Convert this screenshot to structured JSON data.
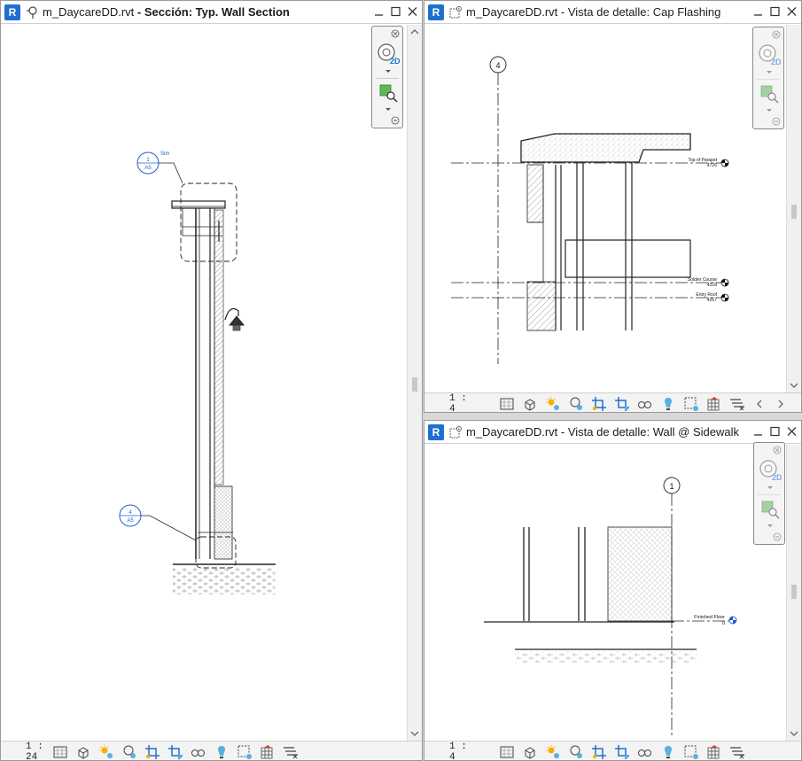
{
  "windows": {
    "left": {
      "file": "m_DaycareDD.rvt",
      "separator": " - ",
      "view": "Sección: Typ. Wall Section",
      "scale": "1 : 24",
      "callouts": [
        {
          "top": "1",
          "bottom": "A5",
          "tag": "Sim"
        },
        {
          "top": "4",
          "bottom": "A5"
        }
      ]
    },
    "top_right": {
      "file": "m_DaycareDD.rvt",
      "separator": " - ",
      "view": "Vista de detalle: Cap Flashing",
      "scale": "1 : 4",
      "grid": "4",
      "levels": [
        {
          "name": "Top of Parapet",
          "value": "4726"
        },
        {
          "name": "Soldier Course",
          "value": "4318"
        },
        {
          "name": "Entry Roof",
          "value": "4267"
        }
      ]
    },
    "bottom_right": {
      "file": "m_DaycareDD.rvt",
      "separator": " - ",
      "view": "Vista de detalle: Wall @ Sidewalk",
      "scale": "1 : 4",
      "grid": "1",
      "levels": [
        {
          "name": "Finished Floor",
          "value": "0"
        }
      ]
    }
  },
  "navbar": {
    "wheel_label": "2D"
  },
  "icons": {
    "app": "revit-logo-icon",
    "minimize": "minimize-icon",
    "maximize": "maximize-icon",
    "close": "close-icon"
  },
  "colors": {
    "revit_blue": "#1f6fd1",
    "callout_blue": "#1f5fcf"
  }
}
